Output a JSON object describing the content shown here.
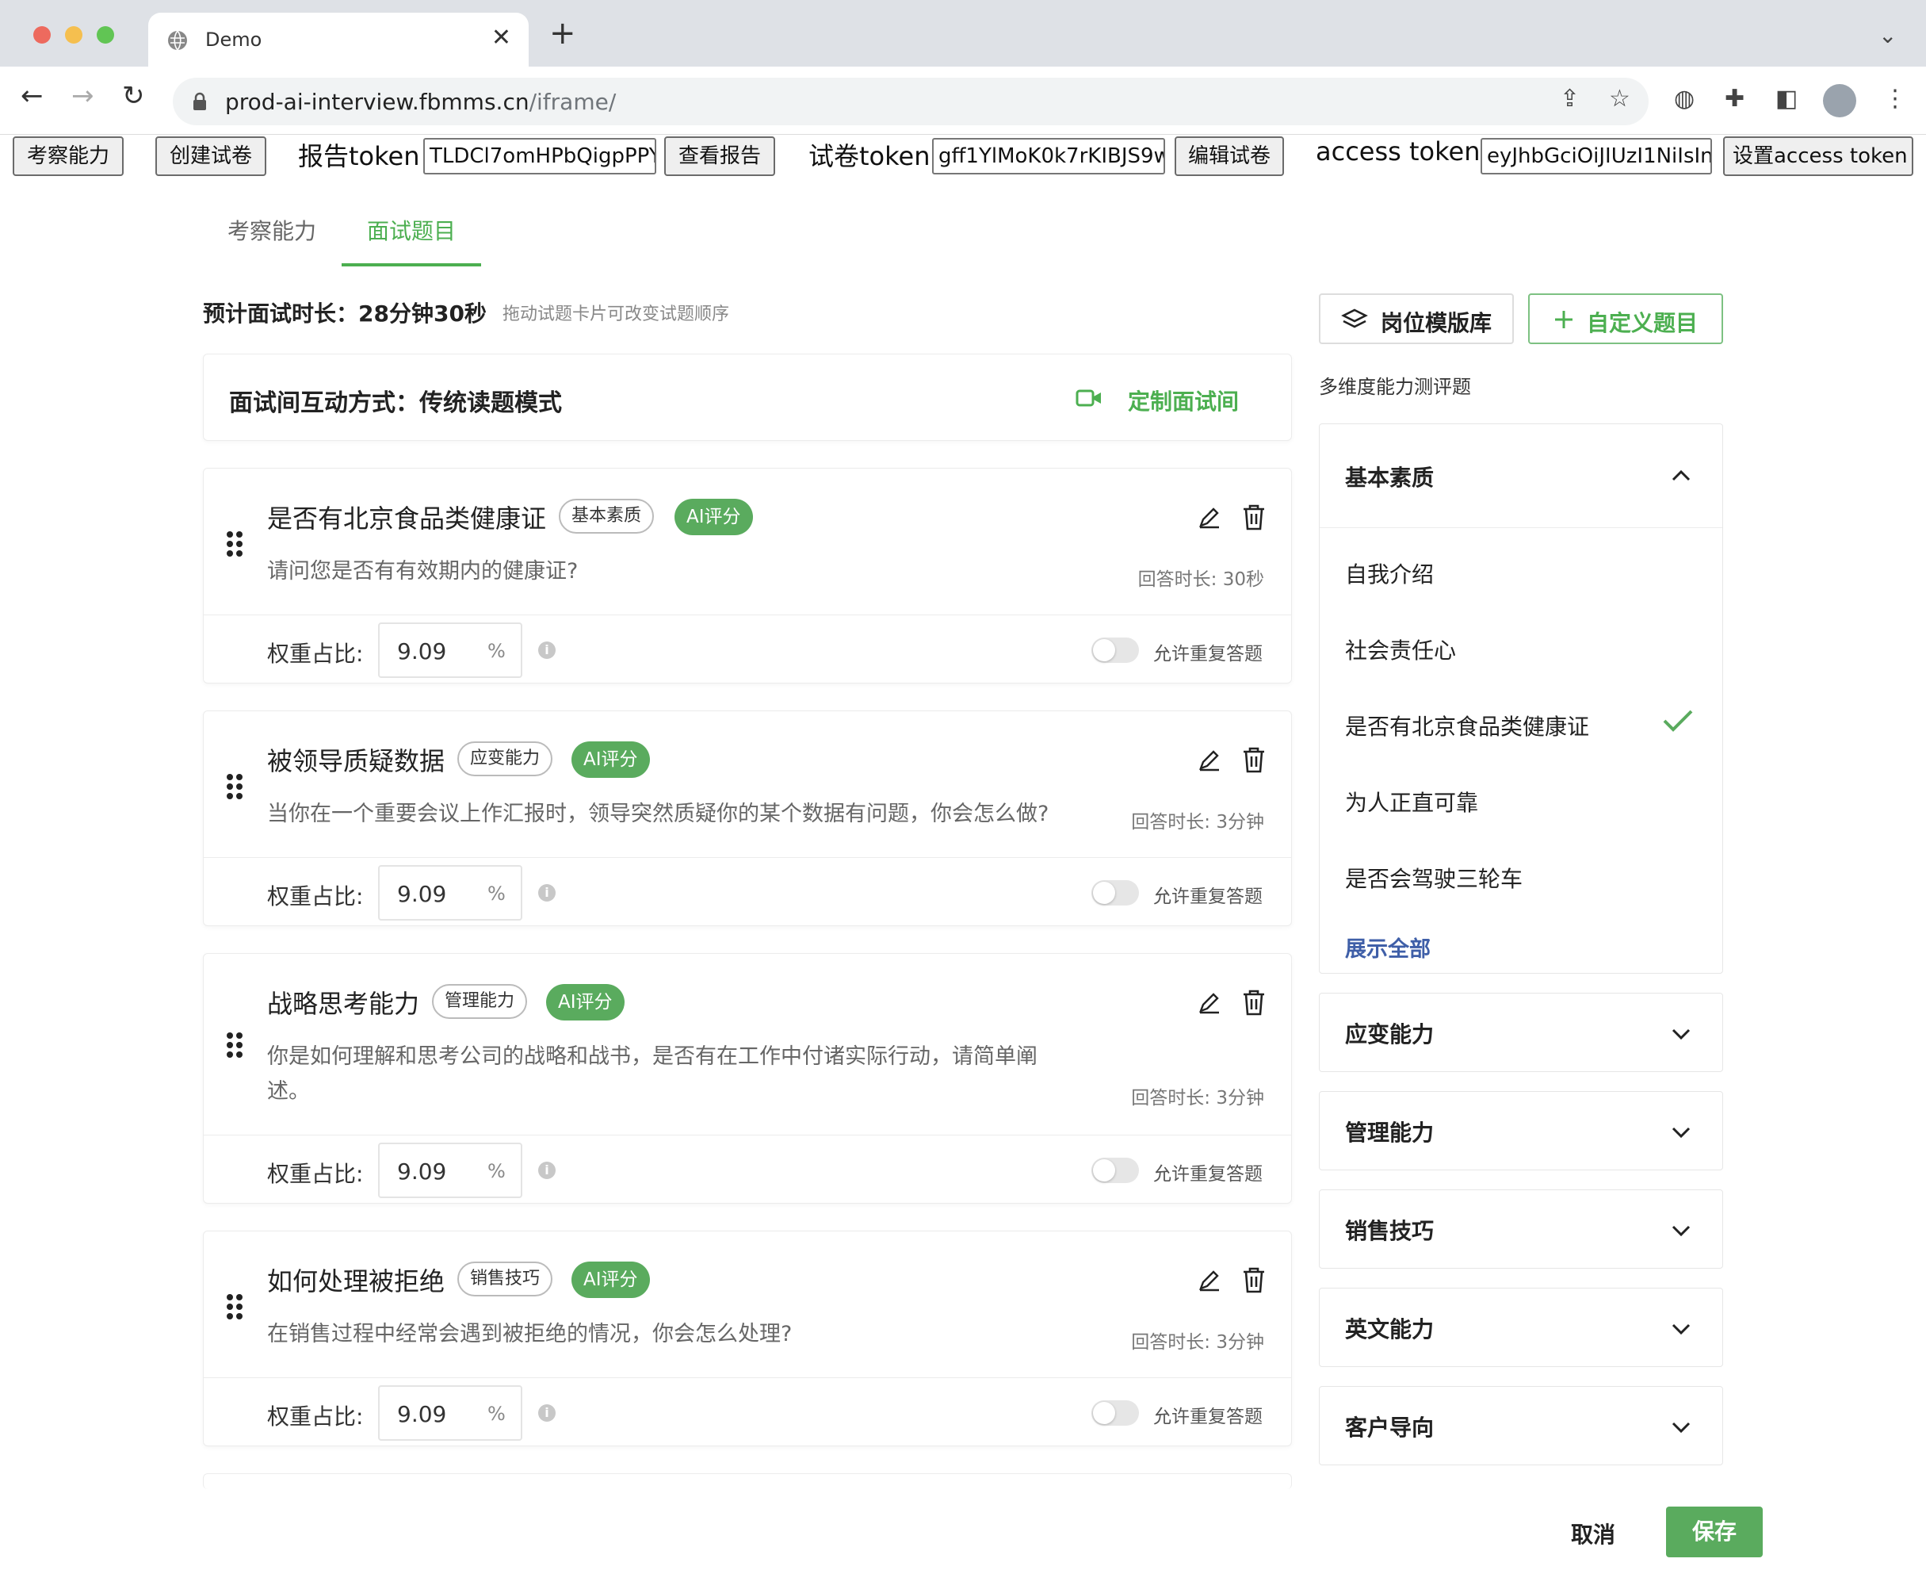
{
  "browser": {
    "tab_title": "Demo",
    "url_host": "prod-ai-interview.fbmms.cn",
    "url_path": "/iframe/"
  },
  "app_toolbar": {
    "btn_ability": "考察能力",
    "btn_create": "创建试卷",
    "report_token_label": "报告token",
    "report_token_value": "TLDCl7omHPbQigpPPY",
    "btn_view_report": "查看报告",
    "paper_token_label": "试卷token",
    "paper_token_value": "gff1YlMoK0k7rKIBJS9w",
    "btn_edit_paper": "编辑试卷",
    "access_token_label": "access token",
    "access_token_value": "eyJhbGciOiJIUzI1NiIsIn",
    "btn_set_access": "设置access token"
  },
  "tabs": [
    "考察能力",
    "面试题目"
  ],
  "duration": "预计面试时长：28分钟30秒",
  "drag_tip": "拖动试题卡片可改变试题顺序",
  "mode": {
    "label": "面试间互动方式：传统读题模式",
    "customize": "定制面试间"
  },
  "questions": [
    {
      "title": "是否有北京食品类健康证",
      "tag": "基本素质",
      "ai": "AI评分",
      "desc": "请问您是否有有效期内的健康证?",
      "answer_time": "回答时长: 30秒",
      "weight_label": "权重占比:",
      "weight": "9.09",
      "pct": "%",
      "repeat_label": "允许重复答题"
    },
    {
      "title": "被领导质疑数据",
      "tag": "应变能力",
      "ai": "AI评分",
      "desc": "当你在一个重要会议上作汇报时，领导突然质疑你的某个数据有问题，你会怎么做?",
      "answer_time": "回答时长: 3分钟",
      "weight_label": "权重占比:",
      "weight": "9.09",
      "pct": "%",
      "repeat_label": "允许重复答题"
    },
    {
      "title": "战略思考能力",
      "tag": "管理能力",
      "ai": "AI评分",
      "desc": "你是如何理解和思考公司的战略和战书，是否有在工作中付诸实际行动，请简单阐述。",
      "answer_time": "回答时长: 3分钟",
      "weight_label": "权重占比:",
      "weight": "9.09",
      "pct": "%",
      "repeat_label": "允许重复答题"
    },
    {
      "title": "如何处理被拒绝",
      "tag": "销售技巧",
      "ai": "AI评分",
      "desc": "在销售过程中经常会遇到被拒绝的情况，你会怎么处理?",
      "answer_time": "回答时长: 3分钟",
      "weight_label": "权重占比:",
      "weight": "9.09",
      "pct": "%",
      "repeat_label": "允许重复答题"
    }
  ],
  "right": {
    "btn_template": "岗位模版库",
    "btn_custom": "自定义题目",
    "section_title": "多维度能力测评题",
    "basic": {
      "title": "基本素质",
      "items": [
        "自我介绍",
        "社会责任心",
        "是否有北京食品类健康证",
        "为人正直可靠",
        "是否会驾驶三轮车"
      ],
      "selected_index": 2,
      "show_all": "展示全部"
    },
    "groups": [
      "应变能力",
      "管理能力",
      "销售技巧",
      "英文能力",
      "客户导向"
    ]
  },
  "footer": {
    "cancel": "取消",
    "save": "保存"
  },
  "colors": {
    "accent": "#4caf50",
    "ai_badge": "#5aab5e",
    "link": "#3f5fa8"
  }
}
